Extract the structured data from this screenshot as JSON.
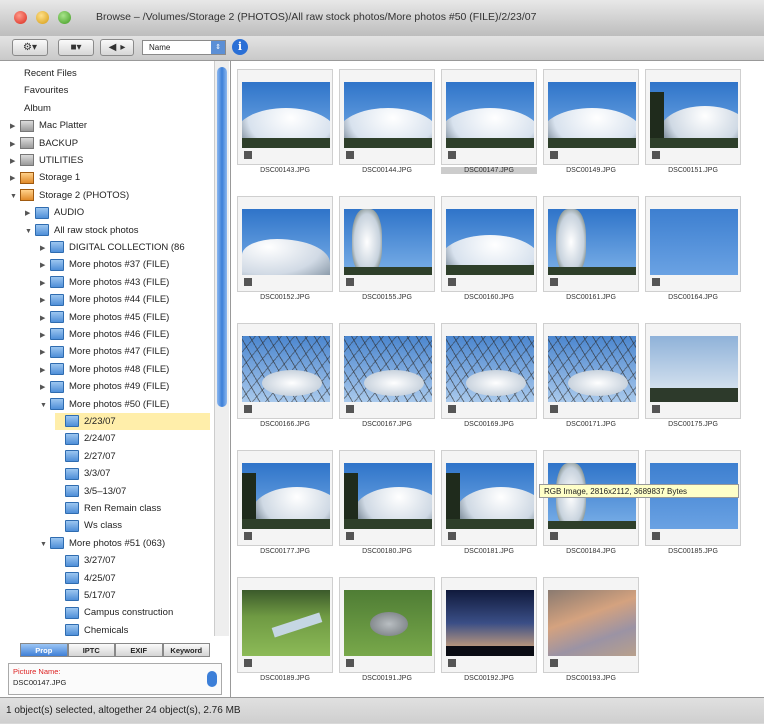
{
  "window": {
    "title": "Browse – /Volumes/Storage 2 (PHOTOS)/All raw stock photos/More photos #50 (FILE)/2/23/07"
  },
  "toolbar": {
    "sort_select": "Name",
    "info_label": "i"
  },
  "sidebar": {
    "tree": [
      {
        "label": "Recent Files",
        "indent": 0,
        "type": "plain"
      },
      {
        "label": "Favourites",
        "indent": 0,
        "type": "plain"
      },
      {
        "label": "Album",
        "indent": 0,
        "type": "plain"
      },
      {
        "label": "Mac Platter",
        "indent": 0,
        "type": "drive",
        "expander": "▶"
      },
      {
        "label": "BACKUP",
        "indent": 0,
        "type": "drive",
        "expander": "▶"
      },
      {
        "label": "UTILITIES",
        "indent": 0,
        "type": "drive",
        "expander": "▶"
      },
      {
        "label": "Storage 1",
        "indent": 0,
        "type": "drive-orange",
        "expander": "▶"
      },
      {
        "label": "Storage 2 (PHOTOS)",
        "indent": 0,
        "type": "drive-orange",
        "expander": "▼"
      },
      {
        "label": "AUDIO",
        "indent": 1,
        "type": "folder",
        "expander": "▶"
      },
      {
        "label": "All raw stock photos",
        "indent": 1,
        "type": "folder",
        "expander": "▼"
      },
      {
        "label": "DIGITAL COLLECTION (86",
        "indent": 2,
        "type": "folder",
        "expander": "▶"
      },
      {
        "label": "More photos #37 (FILE)",
        "indent": 2,
        "type": "folder",
        "expander": "▶"
      },
      {
        "label": "More photos #43 (FILE)",
        "indent": 2,
        "type": "folder",
        "expander": "▶"
      },
      {
        "label": "More photos #44 (FILE)",
        "indent": 2,
        "type": "folder",
        "expander": "▶"
      },
      {
        "label": "More photos #45 (FILE)",
        "indent": 2,
        "type": "folder",
        "expander": "▶"
      },
      {
        "label": "More photos #46 (FILE)",
        "indent": 2,
        "type": "folder",
        "expander": "▶"
      },
      {
        "label": "More photos #47 (FILE)",
        "indent": 2,
        "type": "folder",
        "expander": "▶"
      },
      {
        "label": "More photos #48 (FILE)",
        "indent": 2,
        "type": "folder",
        "expander": "▶"
      },
      {
        "label": "More photos #49 (FILE)",
        "indent": 2,
        "type": "folder",
        "expander": "▶"
      },
      {
        "label": "More photos #50 (FILE)",
        "indent": 2,
        "type": "folder",
        "expander": "▼"
      },
      {
        "label": "2/23/07",
        "indent": 3,
        "type": "folder",
        "selected": true
      },
      {
        "label": "2/24/07",
        "indent": 3,
        "type": "folder"
      },
      {
        "label": "2/27/07",
        "indent": 3,
        "type": "folder"
      },
      {
        "label": "3/3/07",
        "indent": 3,
        "type": "folder"
      },
      {
        "label": "3/5–13/07",
        "indent": 3,
        "type": "folder"
      },
      {
        "label": "Ren Remain class",
        "indent": 3,
        "type": "folder"
      },
      {
        "label": "Ws class",
        "indent": 3,
        "type": "folder"
      },
      {
        "label": "More photos #51 (063)",
        "indent": 2,
        "type": "folder",
        "expander": "▼"
      },
      {
        "label": "3/27/07",
        "indent": 3,
        "type": "folder"
      },
      {
        "label": "4/25/07",
        "indent": 3,
        "type": "folder"
      },
      {
        "label": "5/17/07",
        "indent": 3,
        "type": "folder"
      },
      {
        "label": "Campus construction",
        "indent": 3,
        "type": "folder"
      },
      {
        "label": "Chemicals",
        "indent": 3,
        "type": "folder"
      }
    ],
    "tabs": [
      "Prop",
      "IPTC",
      "EXIF",
      "Keyword"
    ],
    "active_tab": 0,
    "props": {
      "label": "Picture Name:",
      "value": "DSC00147.JPG"
    }
  },
  "thumbs": [
    {
      "name": "DSC00143.JPG",
      "scene": "mountain"
    },
    {
      "name": "DSC00144.JPG",
      "scene": "mountain"
    },
    {
      "name": "DSC00147.JPG",
      "scene": "mountain",
      "highlight": true
    },
    {
      "name": "DSC00149.JPG",
      "scene": "mountain"
    },
    {
      "name": "DSC00151.JPG",
      "scene": "mountain-tree"
    },
    {
      "name": "DSC00152.JPG",
      "scene": "peak"
    },
    {
      "name": "DSC00155.JPG",
      "scene": "snowtree"
    },
    {
      "name": "DSC00160.JPG",
      "scene": "mountain"
    },
    {
      "name": "DSC00161.JPG",
      "scene": "snowtree"
    },
    {
      "name": "DSC00164.JPG",
      "scene": "sky"
    },
    {
      "name": "DSC00166.JPG",
      "scene": "branches"
    },
    {
      "name": "DSC00167.JPG",
      "scene": "branches"
    },
    {
      "name": "DSC00169.JPG",
      "scene": "branches"
    },
    {
      "name": "DSC00171.JPG",
      "scene": "branches"
    },
    {
      "name": "DSC00175.JPG",
      "scene": "haze"
    },
    {
      "name": "DSC00177.JPG",
      "scene": "mountain-tree"
    },
    {
      "name": "DSC00180.JPG",
      "scene": "mountain-tree"
    },
    {
      "name": "DSC00181.JPG",
      "scene": "mountain-tree"
    },
    {
      "name": "DSC00184.JPG",
      "scene": "snowtree"
    },
    {
      "name": "DSC00185.JPG",
      "scene": "sky"
    },
    {
      "name": "DSC00189.JPG",
      "scene": "lawn"
    },
    {
      "name": "DSC00191.JPG",
      "scene": "cat"
    },
    {
      "name": "DSC00192.JPG",
      "scene": "dusk"
    },
    {
      "name": "DSC00193.JPG",
      "scene": "clouds"
    }
  ],
  "tooltip": "RGB Image, 2816x2112, 3689837 Bytes",
  "status": "1 object(s) selected, altogether 24 object(s), 2.76 MB",
  "colors": {
    "accent": "#3c7fd8",
    "selection": "#ffeeaa",
    "tooltip_bg": "#ffffc8"
  }
}
